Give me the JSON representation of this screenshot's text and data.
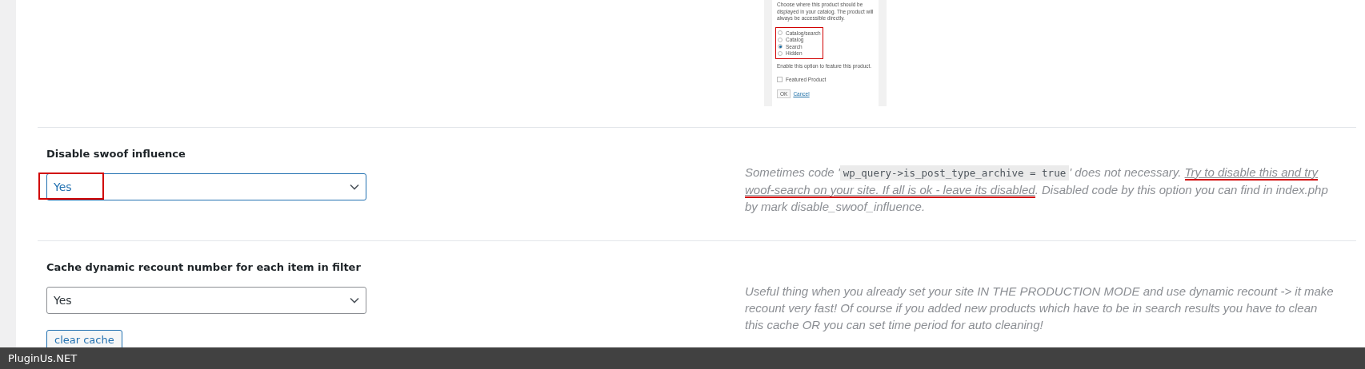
{
  "preview": {
    "intro": "Choose where this product should be displayed in your catalog. The product will always be accessible directly.",
    "annotated": true,
    "options": [
      {
        "label": "Catalog/search",
        "selected": false
      },
      {
        "label": "Catalog",
        "selected": false
      },
      {
        "label": "Search",
        "selected": true
      },
      {
        "label": "Hidden",
        "selected": false
      }
    ],
    "feature_hint": "Enable this option to feature this product.",
    "featured": {
      "label": "Featured Product",
      "checked": false
    },
    "ok_label": "OK",
    "cancel_label": "Cancel"
  },
  "settings": [
    {
      "label": "Disable swoof influence",
      "value": "Yes",
      "focused": true,
      "annotated": true,
      "description": [
        {
          "kind": "text",
          "text": "Sometimes code '"
        },
        {
          "kind": "code",
          "text": "wp_query->is_post_type_archive = true"
        },
        {
          "kind": "text",
          "text": "' does not necessary. "
        },
        {
          "kind": "marked",
          "text": "Try to disable this and try woof-search on your site. If all is ok - leave its disabled"
        },
        {
          "kind": "text",
          "text": ". Disabled code by this option you can find in index.php by mark disable_swoof_influence."
        }
      ]
    },
    {
      "label": "Cache dynamic recount number for each item in filter",
      "value": "Yes",
      "focused": false,
      "annotated": false,
      "button": "clear cache",
      "description": [
        {
          "kind": "text",
          "text": "Useful thing when you already set your site IN THE PRODUCTION MODE and use dynamic recount -> it make recount very fast! Of course if you added new products which have to be in search results you have to clean this cache OR you can set time period for auto cleaning!"
        }
      ]
    }
  ],
  "footer": {
    "brand": "PluginUs.NET"
  }
}
